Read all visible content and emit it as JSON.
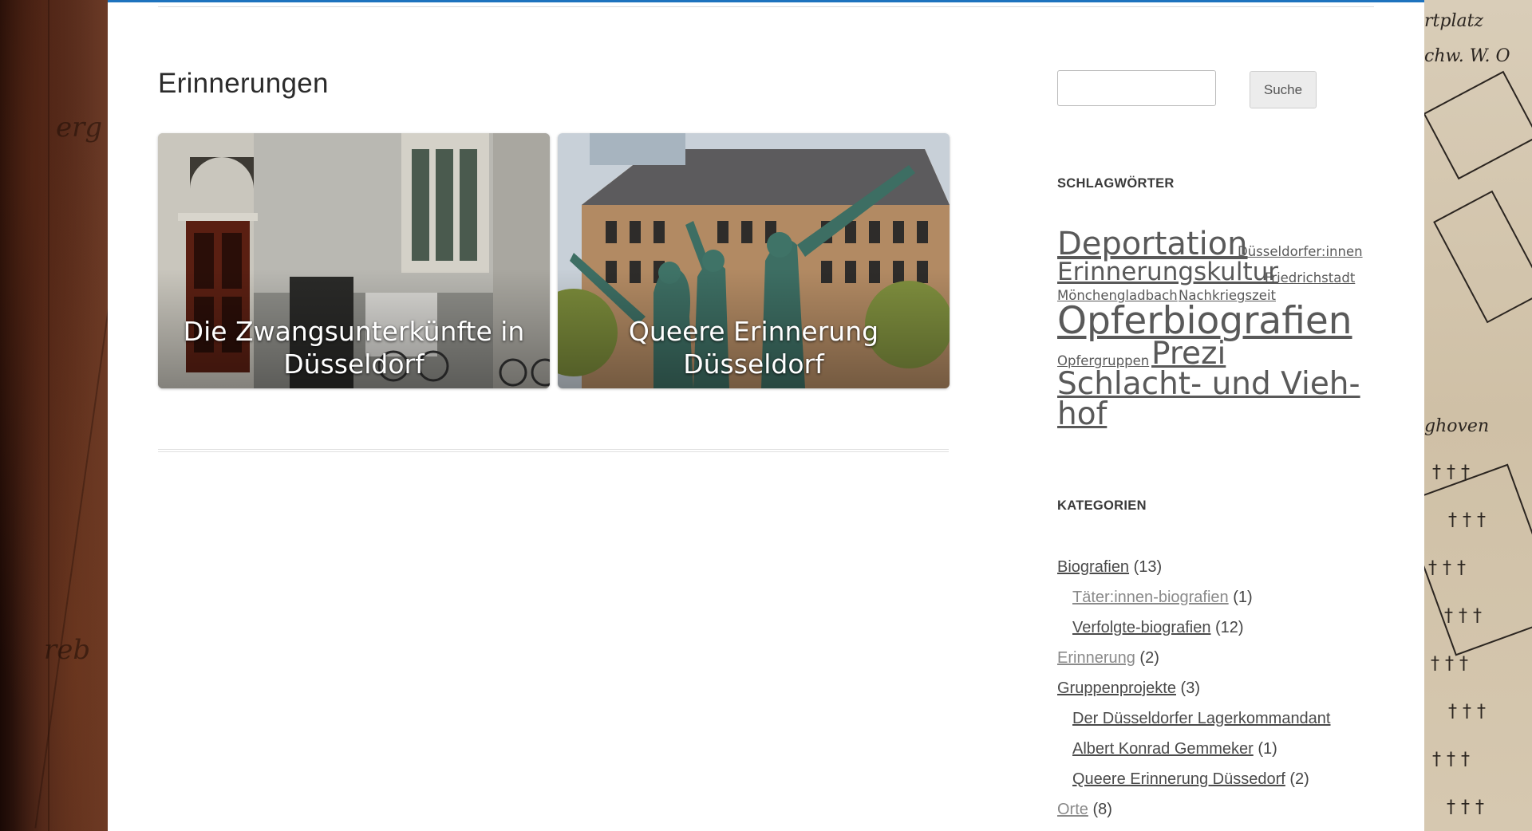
{
  "page": {
    "title": "Erinnerungen"
  },
  "cards": [
    {
      "caption_line1": "Die Zwangsunterkünfte in",
      "caption_line2": "Düsseldorf",
      "image_icon": "building-entrance-photo"
    },
    {
      "caption_line1": "Queere Erinnerung",
      "caption_line2": "Düsseldorf",
      "image_icon": "bronze-statue-group-photo"
    }
  ],
  "search": {
    "placeholder": "",
    "button_label": "Suche"
  },
  "tags_widget": {
    "title": "SCHLAGWÖRTER",
    "tags": [
      "Deportation",
      "Düsseldorfer:innen",
      "Erinnerungskultur",
      "Friedrichstadt",
      "Mönchengladbach",
      "Nachkriegszeit",
      "Opferbiografien",
      "Opfergruppen",
      "Prezi",
      "Schlacht- und Vieh-",
      "hof"
    ]
  },
  "categories_widget": {
    "title": "KATEGORIEN",
    "items": [
      {
        "label": "Biografien",
        "count": "(13)"
      },
      {
        "label": "Täter:innen-biografien",
        "count": "(1)"
      },
      {
        "label": "Verfolgte-biografien",
        "count": "(12)"
      },
      {
        "label": "Erinnerung",
        "count": "(2)"
      },
      {
        "label": "Gruppenprojekte",
        "count": "(3)"
      },
      {
        "label": "Der Düsseldorfer Lagerkommandant",
        "count": ""
      },
      {
        "label": "Albert Konrad Gemmeker",
        "count": "(1)"
      },
      {
        "label": "Queere Erinnerung Düssedorf",
        "count": "(2)"
      },
      {
        "label": "Orte",
        "count": "(8)"
      }
    ]
  },
  "background_map": {
    "left_text": [
      "erg",
      "reb"
    ],
    "right_text": [
      "rtplatz",
      "chw. W. O",
      "ghoven"
    ]
  },
  "colors": {
    "accent_top_border": "#1e73be",
    "link": "#4a4a4a",
    "muted_link": "#8a8a8a"
  }
}
